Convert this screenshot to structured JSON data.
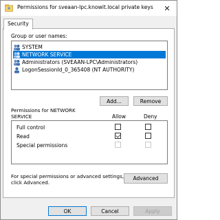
{
  "window": {
    "title": "Permissions for sveaan-lpc.knowit.local private keys",
    "close_glyph": "✕"
  },
  "tabs": [
    {
      "label": "Security",
      "selected": true
    }
  ],
  "groups": {
    "label": "Group or user names:",
    "items": [
      {
        "label": "SYSTEM",
        "selected": false,
        "icon": "users-group-icon"
      },
      {
        "label": "NETWORK SERVICE",
        "selected": true,
        "icon": "users-group-icon"
      },
      {
        "label": "Administrators (SVEAAN-LPC\\Administrators)",
        "selected": false,
        "icon": "users-group-icon"
      },
      {
        "label": "LogonSessionId_0_365408 (NT AUTHORITY)",
        "selected": false,
        "icon": "user-icon"
      }
    ]
  },
  "buttons": {
    "add": "Add...",
    "remove": "Remove",
    "advanced": "Advanced",
    "ok": "OK",
    "cancel": "Cancel",
    "apply": "Apply"
  },
  "permissions": {
    "header_line1": "Permissions for NETWORK",
    "header_line2": "SERVICE",
    "allow_label": "Allow",
    "deny_label": "Deny",
    "rows": [
      {
        "label": "Full control",
        "allow": false,
        "deny": false,
        "enabled": true
      },
      {
        "label": "Read",
        "allow": true,
        "deny": false,
        "enabled": true
      },
      {
        "label": "Special permissions",
        "allow": false,
        "deny": false,
        "enabled": false
      }
    ]
  },
  "advanced_note": {
    "line1": "For special permissions or advanced settings,",
    "line2": "click Advanced."
  },
  "colors": {
    "selection": "#0078d7",
    "window_bg": "#f0f0f0"
  }
}
